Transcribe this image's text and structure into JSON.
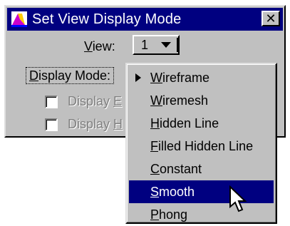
{
  "window": {
    "title": "Set View Display Mode",
    "close_label": "✕"
  },
  "view": {
    "label_accel": "V",
    "label_rest": "iew:",
    "value": "1"
  },
  "display_mode": {
    "label_accel": "D",
    "label_rest": "isplay Mode:"
  },
  "checkboxes": [
    {
      "label_pre": "Display ",
      "accel": "E",
      "checked": false
    },
    {
      "label_pre": "Display ",
      "accel": "H",
      "checked": false
    }
  ],
  "menu": {
    "items": [
      {
        "accel": "W",
        "rest": "ireframe",
        "checked": true,
        "selected": false
      },
      {
        "accel": "W",
        "rest": "iremesh",
        "checked": false,
        "selected": false
      },
      {
        "accel": "H",
        "rest": "idden Line",
        "checked": false,
        "selected": false
      },
      {
        "accel": "F",
        "rest": "illed Hidden Line",
        "checked": false,
        "selected": false
      },
      {
        "accel": "C",
        "rest": "onstant",
        "checked": false,
        "selected": false
      },
      {
        "accel": "S",
        "rest": "mooth",
        "checked": false,
        "selected": true
      },
      {
        "accel": "P",
        "rest": "hong",
        "checked": false,
        "selected": false
      }
    ]
  },
  "colors": {
    "titlebar": "#000080",
    "face": "#c0c0c0",
    "selection": "#000080"
  }
}
